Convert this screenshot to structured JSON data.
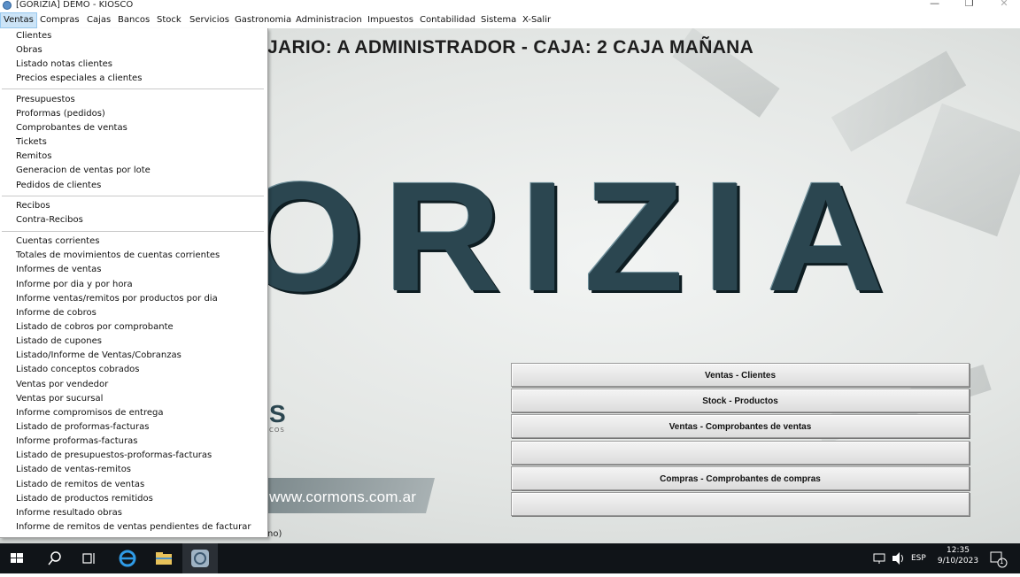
{
  "window": {
    "title": "[GORIZIA] DEMO - KIOSCO",
    "min_glyph": "—",
    "max_glyph": "❐",
    "close_glyph": "✕"
  },
  "menubar": {
    "items": [
      "Ventas",
      "Compras",
      "Cajas",
      "Bancos",
      "Stock",
      "Servicios",
      "Gastronomia",
      "Administracion",
      "Impuestos",
      "Contabilidad",
      "Sistema",
      "X-Salir"
    ],
    "active": "Ventas"
  },
  "header": {
    "headline": "JARIO: A ADMINISTRADOR - CAJA: 2 CAJA MAÑANA"
  },
  "logo": {
    "text": "ORIZIA",
    "brand_letter": "S",
    "brand_small": "COS",
    "website": "www.cormons.com.ar"
  },
  "status_leftover": "no)",
  "dropdown": {
    "groups": [
      [
        "Clientes",
        "Obras",
        "Listado notas clientes",
        "Precios especiales a clientes"
      ],
      [
        "Presupuestos",
        "Proformas (pedidos)",
        "Comprobantes de ventas",
        "Tickets",
        "Remitos",
        "Generacion de ventas por lote",
        "Pedidos de clientes"
      ],
      [
        "Recibos",
        "Contra-Recibos"
      ],
      [
        "Cuentas corrientes",
        "Totales de movimientos de cuentas corrientes",
        "Informes de ventas",
        "Informe por dia y por hora",
        "Informe ventas/remitos por productos por dia",
        "Informe de cobros",
        "Listado de cobros por comprobante",
        "Listado de cupones",
        "Listado/Informe de Ventas/Cobranzas",
        "Listado conceptos cobrados",
        "Ventas por vendedor",
        "Ventas por sucursal",
        "Informe compromisos de entrega",
        "Listado de proformas-facturas",
        "Informe proformas-facturas",
        "Listado de presupuestos-proformas-facturas",
        "Listado de ventas-remitos",
        "Listado de remitos de ventas",
        "Listado de productos remitidos",
        "Informe resultado obras",
        "Informe de remitos de ventas pendientes de facturar"
      ]
    ]
  },
  "buttons": [
    {
      "label": "Ventas - Clientes"
    },
    {
      "label": "Stock - Productos"
    },
    {
      "label": "Ventas - Comprobantes de ventas"
    },
    {
      "label": ""
    },
    {
      "label": "Compras - Comprobantes de compras"
    },
    {
      "label": ""
    }
  ],
  "taskbar": {
    "language": "ESP",
    "time": "12:35",
    "date": "9/10/2023",
    "notification_count": "1"
  },
  "colors": {
    "accent": "#cce4f7",
    "taskbar": "#101418",
    "logo": "#2b4650"
  }
}
